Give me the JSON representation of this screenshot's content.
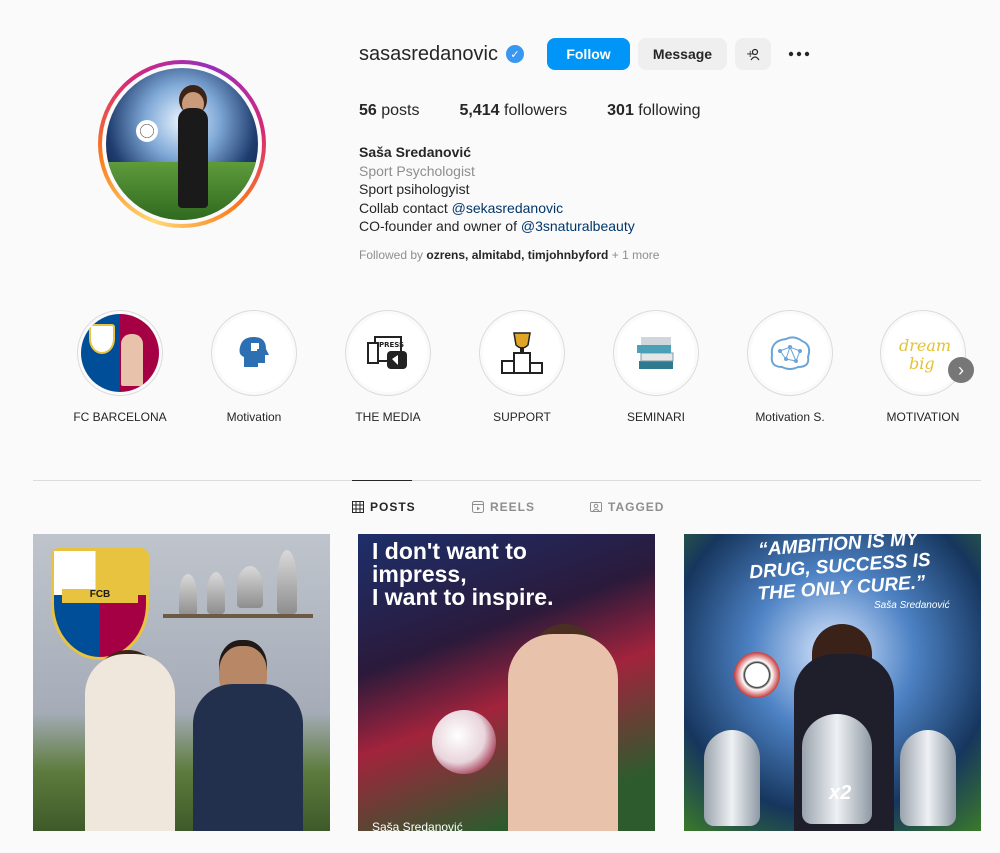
{
  "profile": {
    "username": "sasasredanovic",
    "verified_icon": "verified-check-icon",
    "buttons": {
      "follow": "Follow",
      "message": "Message",
      "add_user_icon": "+☺",
      "more_icon": "•••"
    },
    "stats": {
      "posts_count": "56",
      "posts_label": "posts",
      "followers_count": "5,414",
      "followers_label": "followers",
      "following_count": "301",
      "following_label": "following"
    },
    "bio": {
      "name": "Saša Sredanović",
      "category": "Sport Psychologist",
      "line1": "Sport psihologyist",
      "line2_prefix": "Collab contact ",
      "line2_link": "@sekasredanovic",
      "line3_prefix": "CO-founder and owner of ",
      "line3_link": "@3snaturalbeauty"
    },
    "followed_by": {
      "prefix": "Followed by ",
      "names": "ozrens, almitabd, timjohnbyford",
      "suffix": " + 1 more"
    }
  },
  "highlights": [
    {
      "label": "FC BARCELONA"
    },
    {
      "label": "Motivation"
    },
    {
      "label": "THE MEDIA"
    },
    {
      "label": "SUPPORT"
    },
    {
      "label": "SEMINARI"
    },
    {
      "label": "Motivation S."
    },
    {
      "label": "MOTIVATION"
    }
  ],
  "highlight_texts": {
    "press": "PRESS",
    "dream": "dream",
    "big": "big",
    "fcb": "FCB"
  },
  "tabs": [
    {
      "label": "POSTS",
      "icon": "grid-icon",
      "active": true
    },
    {
      "label": "REELS",
      "icon": "reels-icon",
      "active": false
    },
    {
      "label": "TAGGED",
      "icon": "tagged-icon",
      "active": false
    }
  ],
  "posts": {
    "post1_crest": "FCB",
    "post2_quote_line1": "I don't want to",
    "post2_quote_line2": "impress,",
    "post2_quote_line3": "I want to inspire.",
    "post2_signature": "Saša Sredanović",
    "post3_quote_line1": "“AMBITION IS MY",
    "post3_quote_line2": "DRUG, SUCCESS IS",
    "post3_quote_line3": "THE ONLY CURE.”",
    "post3_signature": "Saša Sredanović",
    "post3_badge": "x2"
  },
  "colors": {
    "follow_button": "#0095f6",
    "link": "#00376b",
    "verified": "#3897f0",
    "secondary_text": "#8e8e8e"
  }
}
